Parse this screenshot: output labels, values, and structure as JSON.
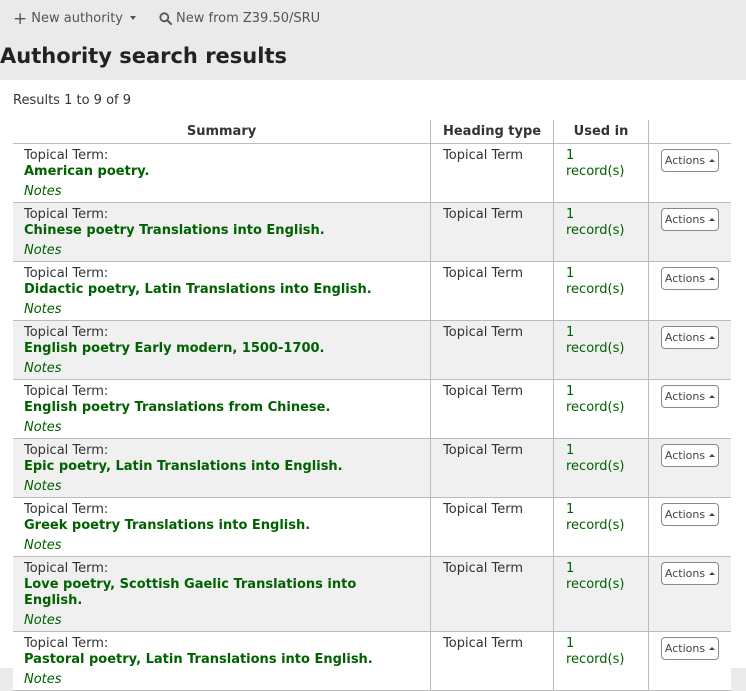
{
  "toolbar": {
    "new_authority_label": "New authority",
    "new_from_z3950_label": "New from Z39.50/SRU"
  },
  "page_title": "Authority search results",
  "results_info": "Results 1 to 9 of 9",
  "table": {
    "headers": [
      "Summary",
      "Heading type",
      "Used in",
      ""
    ],
    "rows": [
      {
        "label": "Topical Term:",
        "heading": "American poetry.",
        "notes": "Notes",
        "heading_type": "Topical Term",
        "used_in": "1 record(s)",
        "actions": "Actions"
      },
      {
        "label": "Topical Term:",
        "heading": "Chinese poetry Translations into English.",
        "notes": "Notes",
        "heading_type": "Topical Term",
        "used_in": "1 record(s)",
        "actions": "Actions"
      },
      {
        "label": "Topical Term:",
        "heading": "Didactic poetry, Latin Translations into English.",
        "notes": "Notes",
        "heading_type": "Topical Term",
        "used_in": "1 record(s)",
        "actions": "Actions"
      },
      {
        "label": "Topical Term:",
        "heading": "English poetry Early modern, 1500-1700.",
        "notes": "Notes",
        "heading_type": "Topical Term",
        "used_in": "1 record(s)",
        "actions": "Actions"
      },
      {
        "label": "Topical Term:",
        "heading": "English poetry Translations from Chinese.",
        "notes": "Notes",
        "heading_type": "Topical Term",
        "used_in": "1 record(s)",
        "actions": "Actions"
      },
      {
        "label": "Topical Term:",
        "heading": "Epic poetry, Latin Translations into English.",
        "notes": "Notes",
        "heading_type": "Topical Term",
        "used_in": "1 record(s)",
        "actions": "Actions"
      },
      {
        "label": "Topical Term:",
        "heading": "Greek poetry Translations into English.",
        "notes": "Notes",
        "heading_type": "Topical Term",
        "used_in": "1 record(s)",
        "actions": "Actions"
      },
      {
        "label": "Topical Term:",
        "heading": "Love poetry, Scottish Gaelic Translations into English.",
        "notes": "Notes",
        "heading_type": "Topical Term",
        "used_in": "1 record(s)",
        "actions": "Actions"
      },
      {
        "label": "Topical Term:",
        "heading": "Pastoral poetry, Latin Translations into English.",
        "notes": "Notes",
        "heading_type": "Topical Term",
        "used_in": "1 record(s)",
        "actions": "Actions"
      }
    ]
  },
  "colors": {
    "link_green": "#006100",
    "background": "#eaeaea",
    "row_alt": "#f0f0f0"
  },
  "icons": [
    "plus-icon",
    "chevron-down-icon",
    "search-icon",
    "caret-up-icon"
  ]
}
